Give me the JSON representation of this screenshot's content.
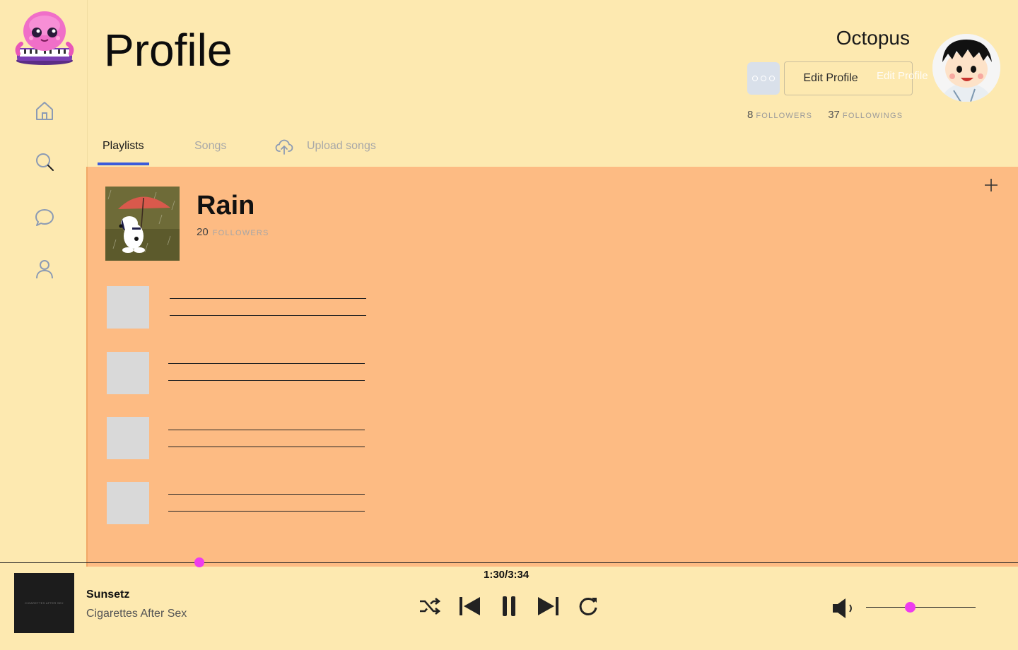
{
  "header": {
    "title": "Profile",
    "username": "Octopus",
    "edit_label": "Edit Profile",
    "edit_label_overlay": "Edit Profile",
    "followers_count": "8",
    "followers_label": "FOLLOWERS",
    "followings_count": "37",
    "followings_label": "FOLLOWINGS"
  },
  "sidebar": {
    "items": [
      {
        "icon": "home-icon"
      },
      {
        "icon": "search-icon"
      },
      {
        "icon": "chat-icon"
      },
      {
        "icon": "user-icon"
      }
    ]
  },
  "tabs": {
    "items": [
      {
        "label": "Playlists",
        "active": true
      },
      {
        "label": "Songs",
        "active": false
      },
      {
        "label": "Upload songs",
        "active": false,
        "icon": "cloud-upload-icon"
      }
    ]
  },
  "playlist": {
    "title": "Rain",
    "followers_count": "20",
    "followers_label": "FOLLOWERS",
    "song_placeholders": 4
  },
  "player": {
    "time": "1:30/3:34",
    "progress_fraction": 0.42,
    "track_title": "Sunsetz",
    "track_artist": "Cigarettes After Sex",
    "album_art_text": "CIGARETTES AFTER SEX",
    "volume_fraction": 0.4,
    "controls": [
      "shuffle-icon",
      "previous-icon",
      "pause-icon",
      "next-icon",
      "repeat-icon"
    ]
  },
  "colors": {
    "background": "#fde9b0",
    "panel": "#fdbb83",
    "accent_tab": "#3b5bdb",
    "knob": "#ee3cee"
  }
}
